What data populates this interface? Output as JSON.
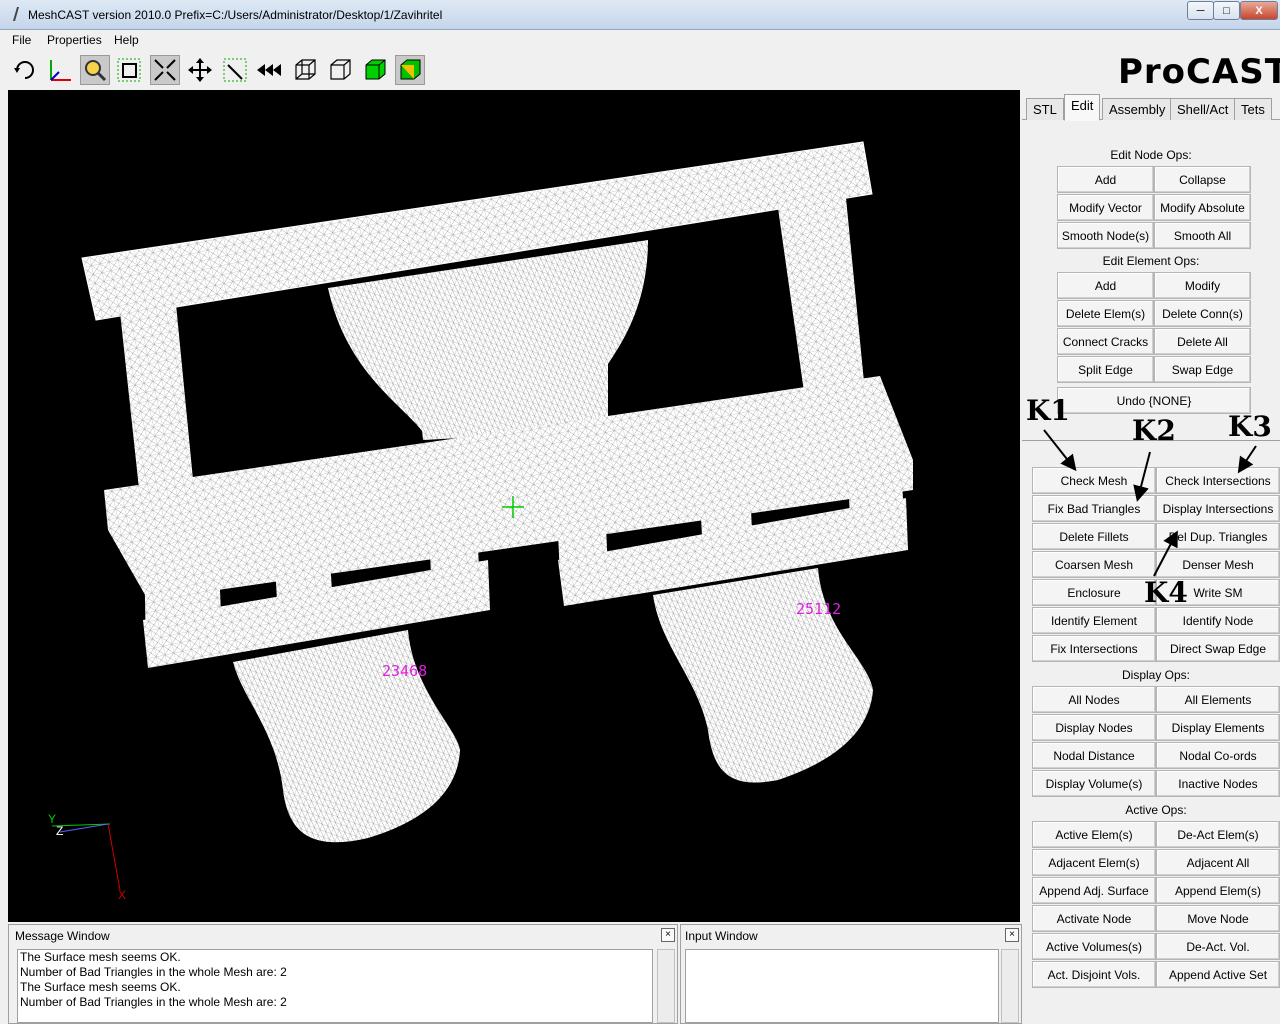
{
  "window": {
    "title": "MeshCAST version 2010.0    Prefix=C:/Users/Administrator/Desktop/1/Zavihritel",
    "min_label": "─",
    "max_label": "□",
    "close_label": "X"
  },
  "menu": {
    "items": [
      "File",
      "Properties",
      "Help"
    ]
  },
  "logo": "ProCAST",
  "tabs": [
    "STL",
    "Edit",
    "Assembly",
    "Shell/Act",
    "Tets"
  ],
  "active_tab": "Edit",
  "edit_node_ops": {
    "label": "Edit Node Ops:",
    "buttons": [
      "Add",
      "Collapse",
      "Modify Vector",
      "Modify Absolute",
      "Smooth Node(s)",
      "Smooth All"
    ]
  },
  "edit_element_ops": {
    "label": "Edit Element Ops:",
    "buttons": [
      "Add",
      "Modify",
      "Delete Elem(s)",
      "Delete Conn(s)",
      "Connect Cracks",
      "Delete All",
      "Split Edge",
      "Swap Edge"
    ]
  },
  "undo_label": "Undo {NONE}",
  "mesh_ops": {
    "buttons": [
      "Check Mesh",
      "Check Intersections",
      "Fix Bad Triangles",
      "Display Intersections",
      "Delete Fillets",
      "Del Dup. Triangles",
      "Coarsen Mesh",
      "Denser Mesh",
      "Enclosure",
      "Write SM",
      "Identify Element",
      "Identify Node",
      "Fix Intersections",
      "Direct Swap Edge"
    ]
  },
  "display_ops": {
    "label": "Display Ops:",
    "buttons": [
      "All Nodes",
      "All Elements",
      "Display Nodes",
      "Display Elements",
      "Nodal Distance",
      "Nodal Co-ords",
      "Display Volume(s)",
      "Inactive Nodes"
    ]
  },
  "active_ops": {
    "label": "Active Ops:",
    "buttons": [
      "Active Elem(s)",
      "De-Act Elem(s)",
      "Adjacent Elem(s)",
      "Adjacent All",
      "Append Adj. Surface",
      "Append Elem(s)",
      "Activate Node",
      "Move Node",
      "Active Volumes(s)",
      "De-Act. Vol.",
      "Act. Disjoint Vols.",
      "Append Active Set"
    ]
  },
  "annotations": [
    "K1",
    "K2",
    "K3",
    "K4"
  ],
  "viewport": {
    "labels": [
      "23468",
      "25112"
    ],
    "axis_labels": {
      "x": "X",
      "y": "Y",
      "z": "Z"
    }
  },
  "message_window": {
    "title": "Message Window",
    "lines": [
      "The Surface mesh seems OK.",
      "Number of Bad Triangles in the whole Mesh are: 2",
      "The Surface mesh seems OK.",
      "Number of Bad Triangles in the whole Mesh are: 2"
    ]
  },
  "input_window": {
    "title": "Input Window",
    "value": ""
  },
  "colors": {
    "viewport_bg": "#000000",
    "mesh": "#ffffff",
    "label": "#e020e0",
    "cursor": "#00cc00"
  },
  "toolbar_icons": [
    "rotate-icon",
    "axes-icon",
    "zoom-icon",
    "select-box-icon",
    "shrink-icon",
    "move-icon",
    "pick-icon",
    "rewind-icon",
    "wireframe-cube-icon",
    "hidden-cube-icon",
    "solid-green-cube-icon",
    "shaded-cube-icon"
  ]
}
